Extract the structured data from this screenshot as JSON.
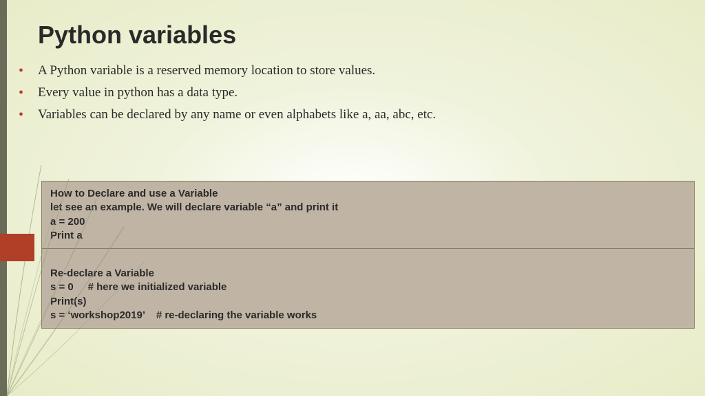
{
  "title": "Python variables",
  "bullets": [
    "A Python variable is a reserved memory location to store values.",
    "Every value in python has a data type.",
    "Variables can be declared by any name or even alphabets like a, aa, abc, etc."
  ],
  "box1": {
    "line1": "How to Declare and use a Variable",
    "line2": "let see an example. We will declare variable “a” and print it",
    "line3": "a = 200",
    "line4": "Print a"
  },
  "box2": {
    "line1": "Re-declare a Variable",
    "line2": "s = 0     # here we initialized variable",
    "line3": "Print(s)",
    "line4": "s = ‘workshop2019’    # re-declaring the variable works"
  }
}
